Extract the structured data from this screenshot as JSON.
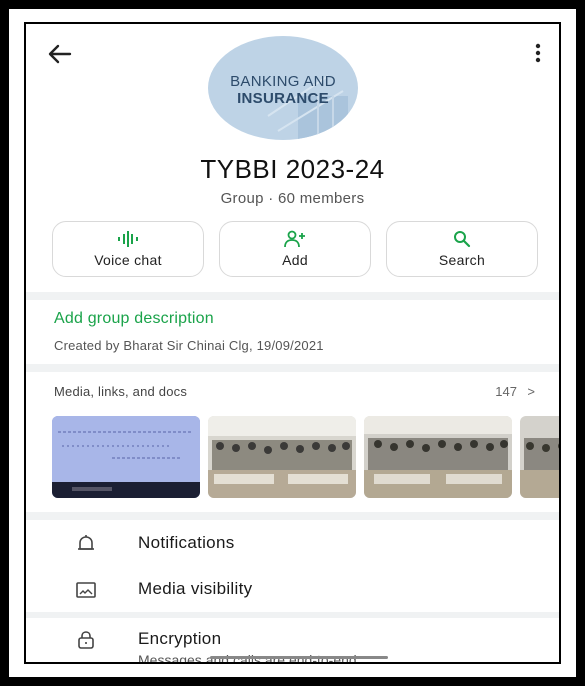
{
  "group": {
    "avatar_text_line1": "BANKING AND",
    "avatar_text_line2": "INSURANCE",
    "name": "TYBBI 2023-24",
    "meta": "Group · 60 members"
  },
  "actions": [
    {
      "label": "Voice chat",
      "icon": "voice-chat-icon"
    },
    {
      "label": "Add",
      "icon": "add-person-icon"
    },
    {
      "label": "Search",
      "icon": "search-icon"
    }
  ],
  "description": {
    "add_label": "Add group description",
    "created_by": "Created by Bharat Sir Chinai Clg, 19/09/2021"
  },
  "media": {
    "header": "Media, links, and docs",
    "count": "147",
    "chevron": ">"
  },
  "settings": [
    {
      "label": "Notifications",
      "icon": "bell-icon"
    },
    {
      "label": "Media visibility",
      "icon": "image-icon"
    },
    {
      "label": "Encryption",
      "icon": "lock-icon",
      "subtitle": "Messages and calls are end-to-end"
    }
  ],
  "colors": {
    "accent": "#1aa34a",
    "separator": "#f0f2f3"
  }
}
